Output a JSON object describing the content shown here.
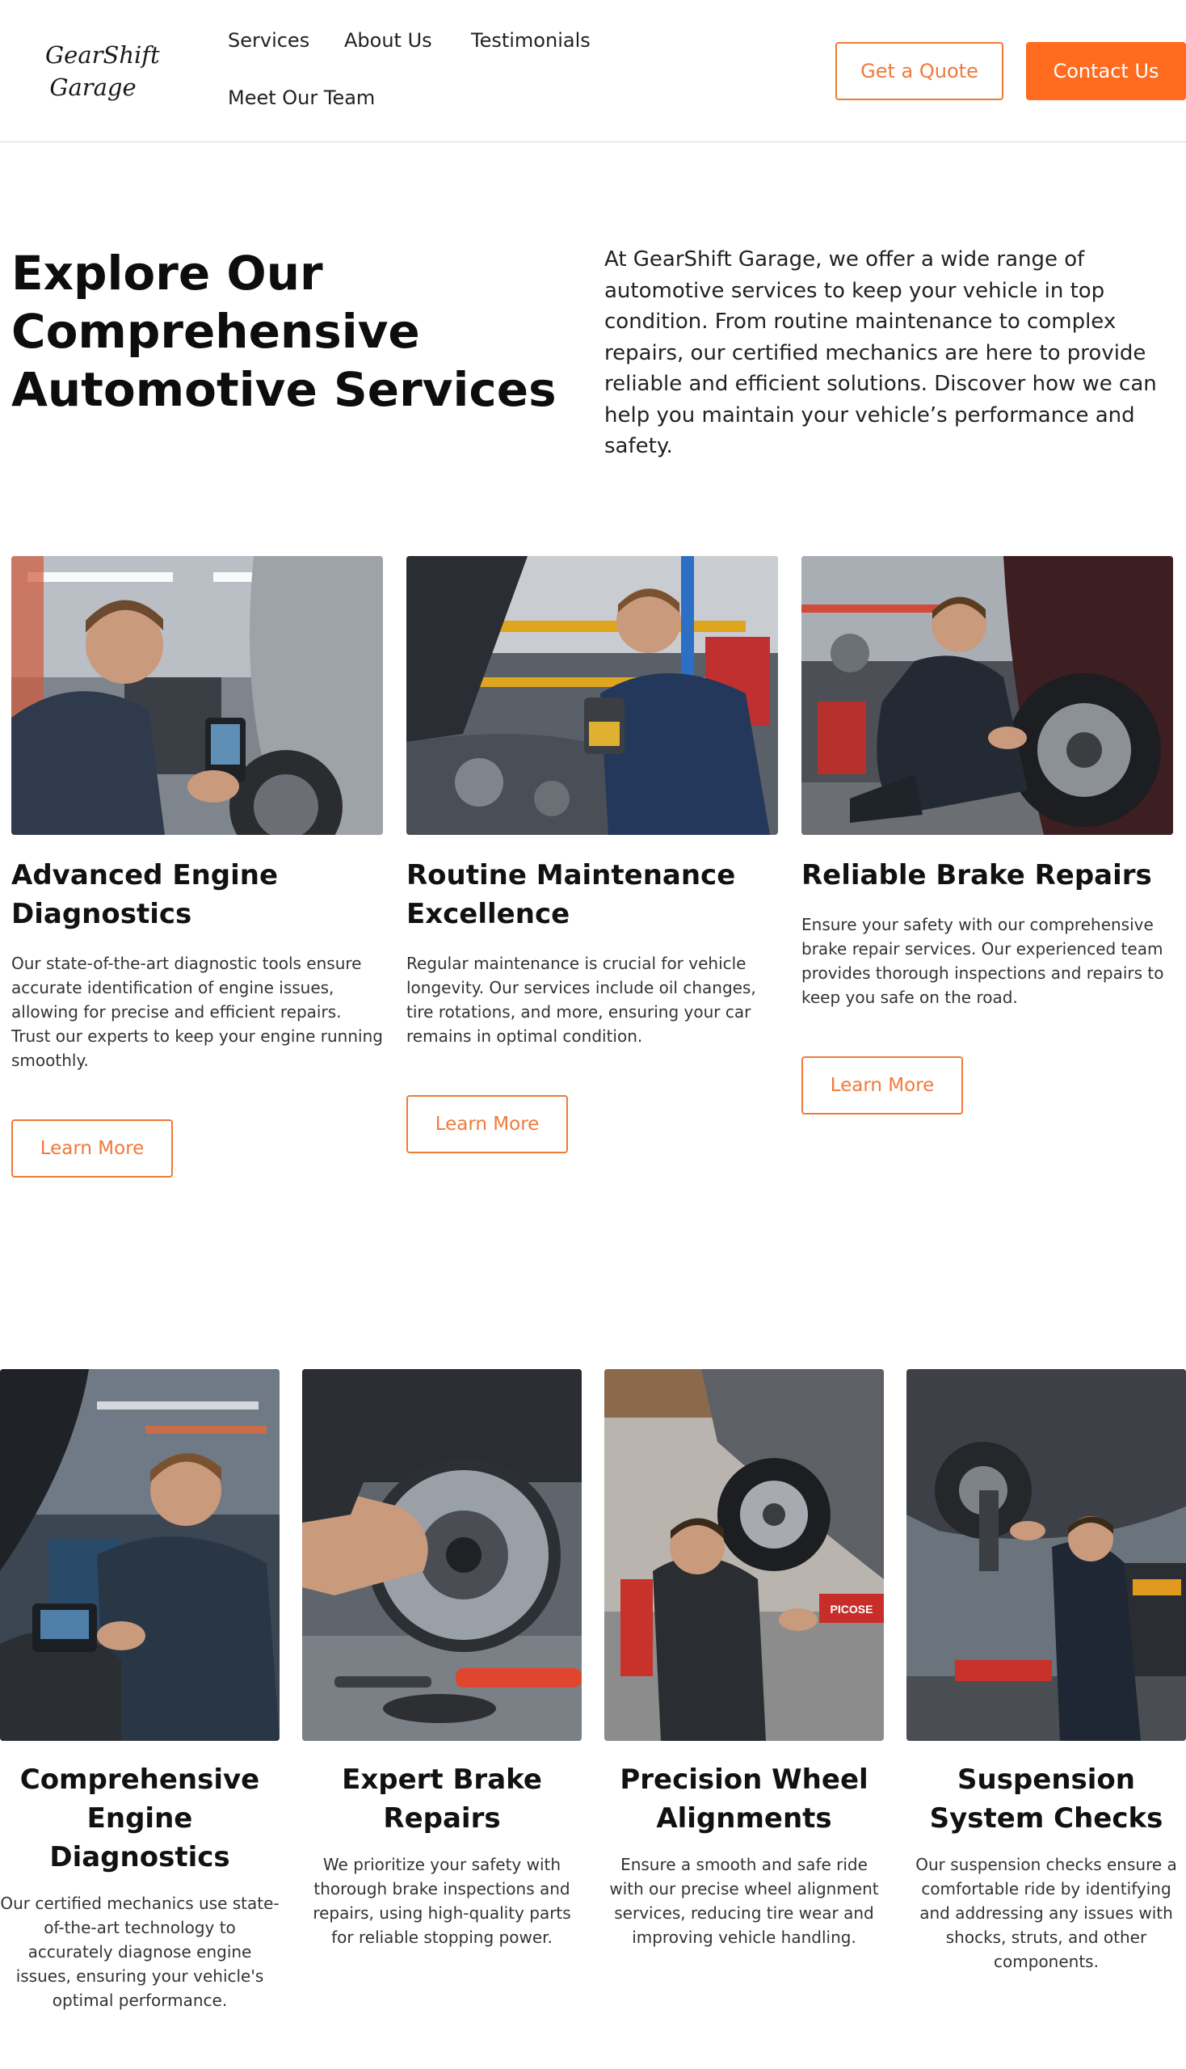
{
  "header": {
    "logo_line1": "GearShift",
    "logo_line2": "Garage",
    "nav": [
      "Services",
      "About Us",
      "Testimonials",
      "Meet Our Team"
    ],
    "quote_label": "Get a Quote",
    "contact_label": "Contact Us"
  },
  "intro": {
    "title": "Explore Our Comprehensive Automotive Services",
    "text": "At GearShift Garage, we offer a wide range of automotive services to keep your vehicle in top condition. From routine maintenance to complex repairs, our certified mechanics are here to provide reliable and efficient solutions. Discover how we can help you maintain your vehicle’s performance and safety."
  },
  "services_row1": [
    {
      "title": "Advanced Engine Diagnostics",
      "text": "Our state-of-the-art diagnostic tools ensure accurate identification of engine issues, allowing for precise and efficient repairs. Trust our experts to keep your engine running smoothly.",
      "button": "Learn More"
    },
    {
      "title": "Routine Maintenance Excellence",
      "text": "Regular maintenance is crucial for vehicle longevity. Our services include oil changes, tire rotations, and more, ensuring your car remains in optimal condition.",
      "button": "Learn More"
    },
    {
      "title": "Reliable Brake Repairs",
      "text": "Ensure your safety with our comprehensive brake repair services. Our experienced team provides thorough inspections and repairs to keep you safe on the road.",
      "button": "Learn More"
    }
  ],
  "services_row2": [
    {
      "title": "Comprehensive Engine Diagnostics",
      "text": "Our certified mechanics use state-of-the-art technology to accurately diagnose engine issues, ensuring your vehicle's optimal performance."
    },
    {
      "title": "Expert Brake Repairs",
      "text": "We prioritize your safety with thorough brake inspections and repairs, using high-quality parts for reliable stopping power."
    },
    {
      "title": "Precision Wheel Alignments",
      "text": "Ensure a smooth and safe ride with our precise wheel alignment services, reducing tire wear and improving vehicle handling.",
      "photo_sign": "PICOSE"
    },
    {
      "title": "Suspension System Checks",
      "text": "Our suspension checks ensure a comfortable ride by identifying and addressing any issues with shocks, struts, and other components."
    }
  ],
  "colors": {
    "accent": "#ff6b1f",
    "accent_outline": "#ef7a3a",
    "text": "#111111"
  }
}
